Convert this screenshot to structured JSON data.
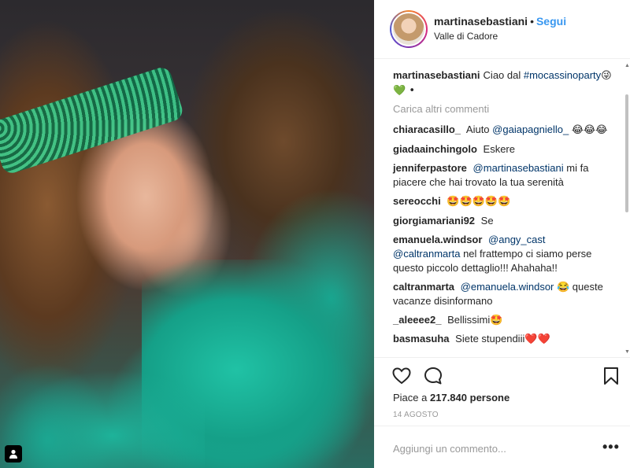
{
  "post": {
    "username": "martinasebastiani",
    "follow_label": "Segui",
    "separator": "•",
    "location": "Valle di Cadore"
  },
  "caption": {
    "username": "martinasebastiani",
    "text": "Ciao dal",
    "hashtag": "#mocassinoparty",
    "emojis": "😜💚 •"
  },
  "load_more": "Carica altri commenti",
  "comments": [
    {
      "user": "chiaracasillo_",
      "pre": "Aiuto",
      "mention": "@gaiapagniello_",
      "post": "😂😂😂"
    },
    {
      "user": "giadaainchingolo",
      "pre": "Eskere",
      "mention": "",
      "post": ""
    },
    {
      "user": "jenniferpastore",
      "pre": "",
      "mention": "@martinasebastiani",
      "post": "mi fa piacere che hai trovato la tua serenità"
    },
    {
      "user": "sereocchi",
      "pre": "🤩🤩🤩🤩🤩",
      "mention": "",
      "post": ""
    },
    {
      "user": "giorgiamariani92",
      "pre": "Se",
      "mention": "",
      "post": ""
    },
    {
      "user": "emanuela.windsor",
      "pre": "",
      "mention": "@angy_cast @caltranmarta",
      "post": "nel frattempo ci siamo perse questo piccolo dettaglio!!! Ahahaha!!"
    },
    {
      "user": "caltranmarta",
      "pre": "",
      "mention": "@emanuela.windsor",
      "post": "😂 queste vacanze disinformano"
    },
    {
      "user": "_aleeee2_",
      "pre": "Bellissimi🤩",
      "mention": "",
      "post": ""
    },
    {
      "user": "basmasuha",
      "pre": "Siete stupendiii❤️❤️",
      "mention": "",
      "post": ""
    }
  ],
  "likes": {
    "prefix": "Piace a",
    "count": "217.840",
    "suffix": "persone"
  },
  "date": "14 AGOSTO",
  "add_comment": {
    "placeholder": "Aggiungi un commento...",
    "more": "•••"
  },
  "icons": {
    "like": "heart-outline-icon",
    "comment": "speech-bubble-icon",
    "save": "bookmark-icon",
    "tagged": "person-tag-icon"
  },
  "colors": {
    "link": "#003569",
    "follow": "#3897f0",
    "muted": "#999999"
  }
}
